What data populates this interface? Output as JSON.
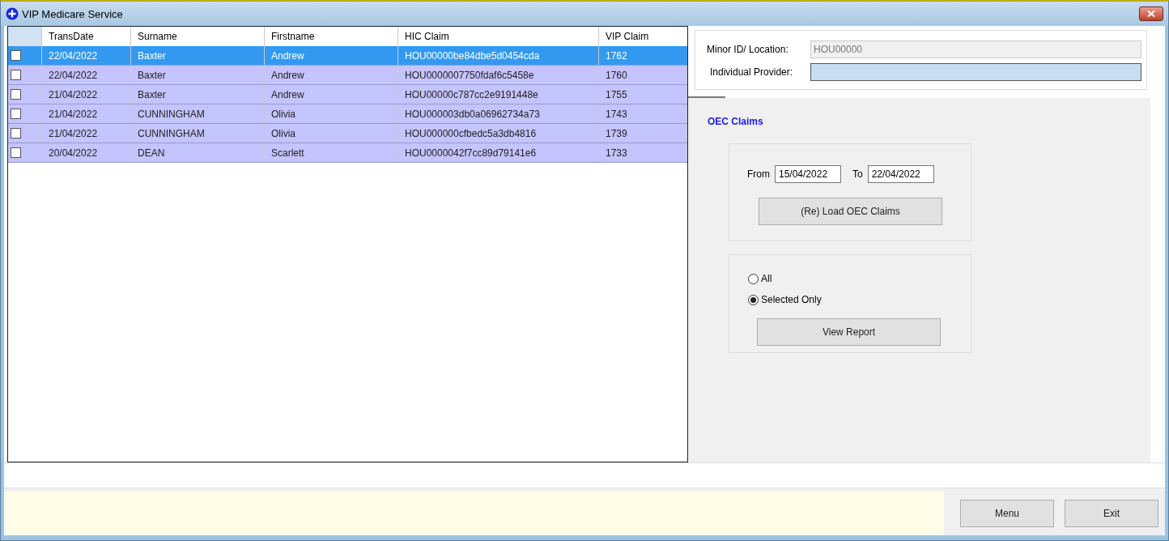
{
  "window": {
    "title": "VIP Medicare Service"
  },
  "table": {
    "columns": [
      "TransDate",
      "Surname",
      "Firstname",
      "HIC Claim",
      "VIP Claim"
    ],
    "rows": [
      {
        "selected": true,
        "checked": false,
        "cells": [
          "22/04/2022",
          "Baxter",
          "Andrew",
          "HOU00000be84dbe5d0454cda",
          "1762"
        ]
      },
      {
        "selected": false,
        "checked": false,
        "cells": [
          "22/04/2022",
          "Baxter",
          "Andrew",
          "HOU0000007750fdaf6c5458e",
          "1760"
        ]
      },
      {
        "selected": false,
        "checked": false,
        "cells": [
          "21/04/2022",
          "Baxter",
          "Andrew",
          "HOU00000c787cc2e9191448e",
          "1755"
        ]
      },
      {
        "selected": false,
        "checked": false,
        "cells": [
          "21/04/2022",
          "CUNNINGHAM",
          "Olivia",
          "HOU000003db0a06962734a73",
          "1743"
        ]
      },
      {
        "selected": false,
        "checked": false,
        "cells": [
          "21/04/2022",
          "CUNNINGHAM",
          "Olivia",
          "HOU000000cfbedc5a3db4816",
          "1739"
        ]
      },
      {
        "selected": false,
        "checked": false,
        "cells": [
          "20/04/2022",
          "DEAN",
          "Scarlett",
          "HOU0000042f7cc89d79141e6",
          "1733"
        ]
      }
    ]
  },
  "provider": {
    "location_label": "Minor ID/ Location:",
    "location_value": "HOU00000",
    "provider_label": "Individual Provider:"
  },
  "oec": {
    "heading": "OEC Claims",
    "from_label": "From",
    "from_value": "15/04/2022",
    "to_label": "To",
    "to_value": "22/04/2022",
    "load_button": "(Re) Load OEC Claims",
    "options": [
      {
        "label": "All",
        "selected": false
      },
      {
        "label": "Selected Only",
        "selected": true
      }
    ],
    "report_button": "View Report"
  },
  "buttons": [
    "Menu",
    "Exit"
  ]
}
